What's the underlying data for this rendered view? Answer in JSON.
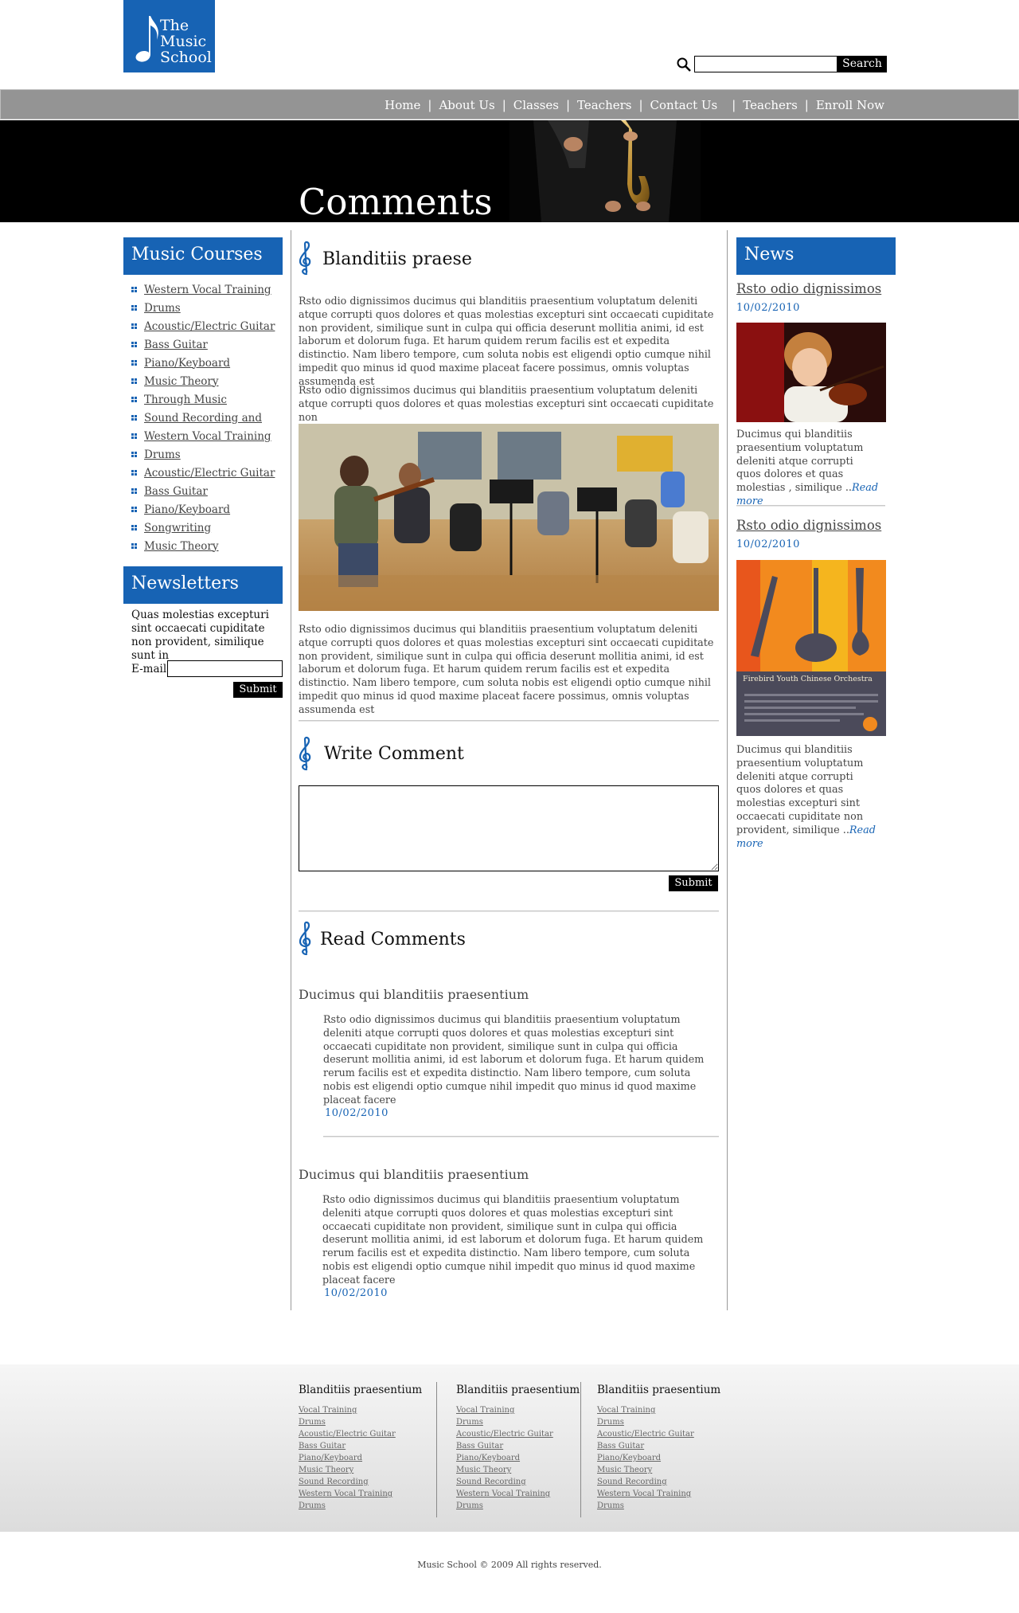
{
  "logo": {
    "line1": "The",
    "line2": "Music",
    "line3": "School"
  },
  "search": {
    "button": "Search"
  },
  "nav": {
    "items": [
      "Home",
      "About Us",
      "Classes",
      "Teachers",
      "Contact Us",
      "Teachers",
      "Enroll Now"
    ]
  },
  "banner": {
    "title": "Comments"
  },
  "courses": {
    "heading": "Music Courses",
    "items": [
      "Western Vocal Training",
      "Drums",
      "Acoustic/Electric Guitar",
      "Bass Guitar",
      "Piano/Keyboard",
      "Music Theory",
      "Through Music",
      "Sound Recording and",
      "Western Vocal Training",
      "Drums",
      "Acoustic/Electric Guitar",
      "Bass Guitar",
      "Piano/Keyboard",
      "Songwriting",
      "Music Theory"
    ]
  },
  "newsletter": {
    "heading": "Newsletters",
    "text": "Quas molestias excepturi sint occaecati cupiditate non provident, similique sunt in",
    "email_label": "E-mail",
    "submit": "Submit"
  },
  "article": {
    "heading": "Blanditiis praese",
    "para1": "Rsto odio dignissimos ducimus qui blanditiis praesentium voluptatum deleniti atque corrupti quos dolores et quas molestias excepturi sint occaecati cupiditate non provident, similique sunt in culpa qui officia deserunt mollitia animi, id est laborum et dolorum fuga. Et harum quidem rerum facilis est et expedita distinctio. Nam libero tempore, cum soluta nobis est eligendi optio cumque nihil impedit quo minus id quod maxime placeat facere possimus, omnis voluptas assumenda est",
    "para2": "Rsto odio dignissimos ducimus qui blanditiis praesentium voluptatum deleniti atque corrupti quos dolores et quas molestias excepturi sint occaecati cupiditate non",
    "para3": "Rsto odio dignissimos ducimus qui blanditiis praesentium voluptatum deleniti atque corrupti quos dolores et quas molestias excepturi sint occaecati cupiditate non provident, similique sunt in culpa qui officia deserunt mollitia animi, id est laborum et dolorum fuga. Et harum quidem rerum facilis est et expedita distinctio. Nam libero tempore, cum soluta nobis est eligendi optio cumque nihil impedit quo minus id quod maxime placeat facere possimus, omnis voluptas assumenda est"
  },
  "write_comment": {
    "heading": "Write Comment",
    "submit": "Submit"
  },
  "read_comments": {
    "heading": "Read Comments",
    "comments": [
      {
        "title": "Ducimus qui blanditiis praesentium",
        "body": "Rsto odio dignissimos ducimus qui blanditiis praesentium voluptatum deleniti atque corrupti quos dolores et quas molestias excepturi sint occaecati cupiditate non provident, similique sunt in culpa qui officia deserunt mollitia animi, id est laborum et dolorum fuga. Et harum quidem rerum facilis est et expedita distinctio. Nam libero tempore, cum soluta nobis est eligendi optio cumque nihil impedit quo minus id quod maxime placeat facere",
        "date": "10/02/2010"
      },
      {
        "title": "Ducimus qui blanditiis praesentium",
        "body": "Rsto odio dignissimos ducimus qui blanditiis praesentium voluptatum deleniti atque corrupti quos dolores et quas molestias excepturi sint occaecati cupiditate non provident, similique sunt in culpa qui officia deserunt mollitia animi, id est laborum et dolorum fuga. Et harum quidem rerum facilis est et expedita distinctio. Nam libero tempore, cum soluta nobis est eligendi optio cumque nihil impedit quo minus id quod maxime placeat facere",
        "date": "10/02/2010"
      }
    ]
  },
  "news": {
    "heading": "News",
    "items": [
      {
        "title": "Rsto odio dignissimos",
        "date": "10/02/2010",
        "text": "Ducimus qui blanditiis praesentium voluptatum deleniti atque corrupti quos dolores et quas molestias ,  similique ..",
        "more": "Read more"
      },
      {
        "title": "Rsto odio dignissimos",
        "date": "10/02/2010",
        "text": "Ducimus qui blanditiis praesentium voluptatum deleniti atque corrupti quos dolores et quas molestias excepturi sint occaecati cupiditate non provident, similique ..",
        "more": "Read more",
        "poster_title": "Firebird Youth Chinese Orchestra"
      }
    ]
  },
  "footer": {
    "columns": [
      {
        "heading": "Blanditiis praesentium",
        "links": [
          "Vocal Training",
          "Drums",
          "Acoustic/Electric Guitar",
          "Bass Guitar",
          "Piano/Keyboard",
          "Music Theory",
          "Sound Recording",
          "Western Vocal Training",
          "Drums"
        ]
      },
      {
        "heading": "Blanditiis praesentium",
        "links": [
          "Vocal Training",
          "Drums",
          "Acoustic/Electric Guitar",
          "Bass Guitar",
          "Piano/Keyboard",
          "Music Theory",
          "Sound Recording",
          "Western Vocal Training",
          "Drums"
        ]
      },
      {
        "heading": "Blanditiis praesentium",
        "links": [
          "Vocal Training",
          "Drums",
          "Acoustic/Electric Guitar",
          "Bass Guitar",
          "Piano/Keyboard",
          "Music Theory",
          "Sound Recording",
          "Western Vocal Training",
          "Drums"
        ]
      }
    ],
    "copyright": "Music School © 2009 All rights reserved."
  },
  "colors": {
    "brand_blue": "#1763b4",
    "nav_gray": "#949494",
    "banner_black": "#000000"
  }
}
